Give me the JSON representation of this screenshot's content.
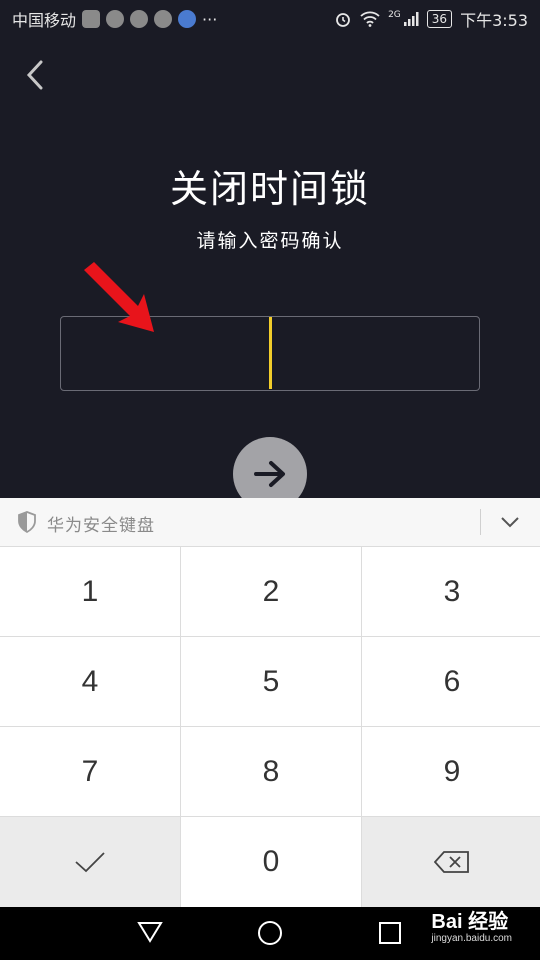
{
  "status_bar": {
    "carrier": "中国移动",
    "more": "···",
    "network": "2G",
    "battery": "36",
    "time": "下午3:53"
  },
  "page": {
    "title": "关闭时间锁",
    "subtitle": "请输入密码确认"
  },
  "keyboard": {
    "title": "华为安全键盘",
    "keys": [
      "1",
      "2",
      "3",
      "4",
      "5",
      "6",
      "7",
      "8",
      "9",
      "0"
    ]
  },
  "watermark": {
    "brand": "Bai 经验",
    "url": "jingyan.baidu.com"
  },
  "colors": {
    "background": "#1a1b25",
    "cursor": "#f2cd2b",
    "annotation_arrow": "#e8141b"
  }
}
